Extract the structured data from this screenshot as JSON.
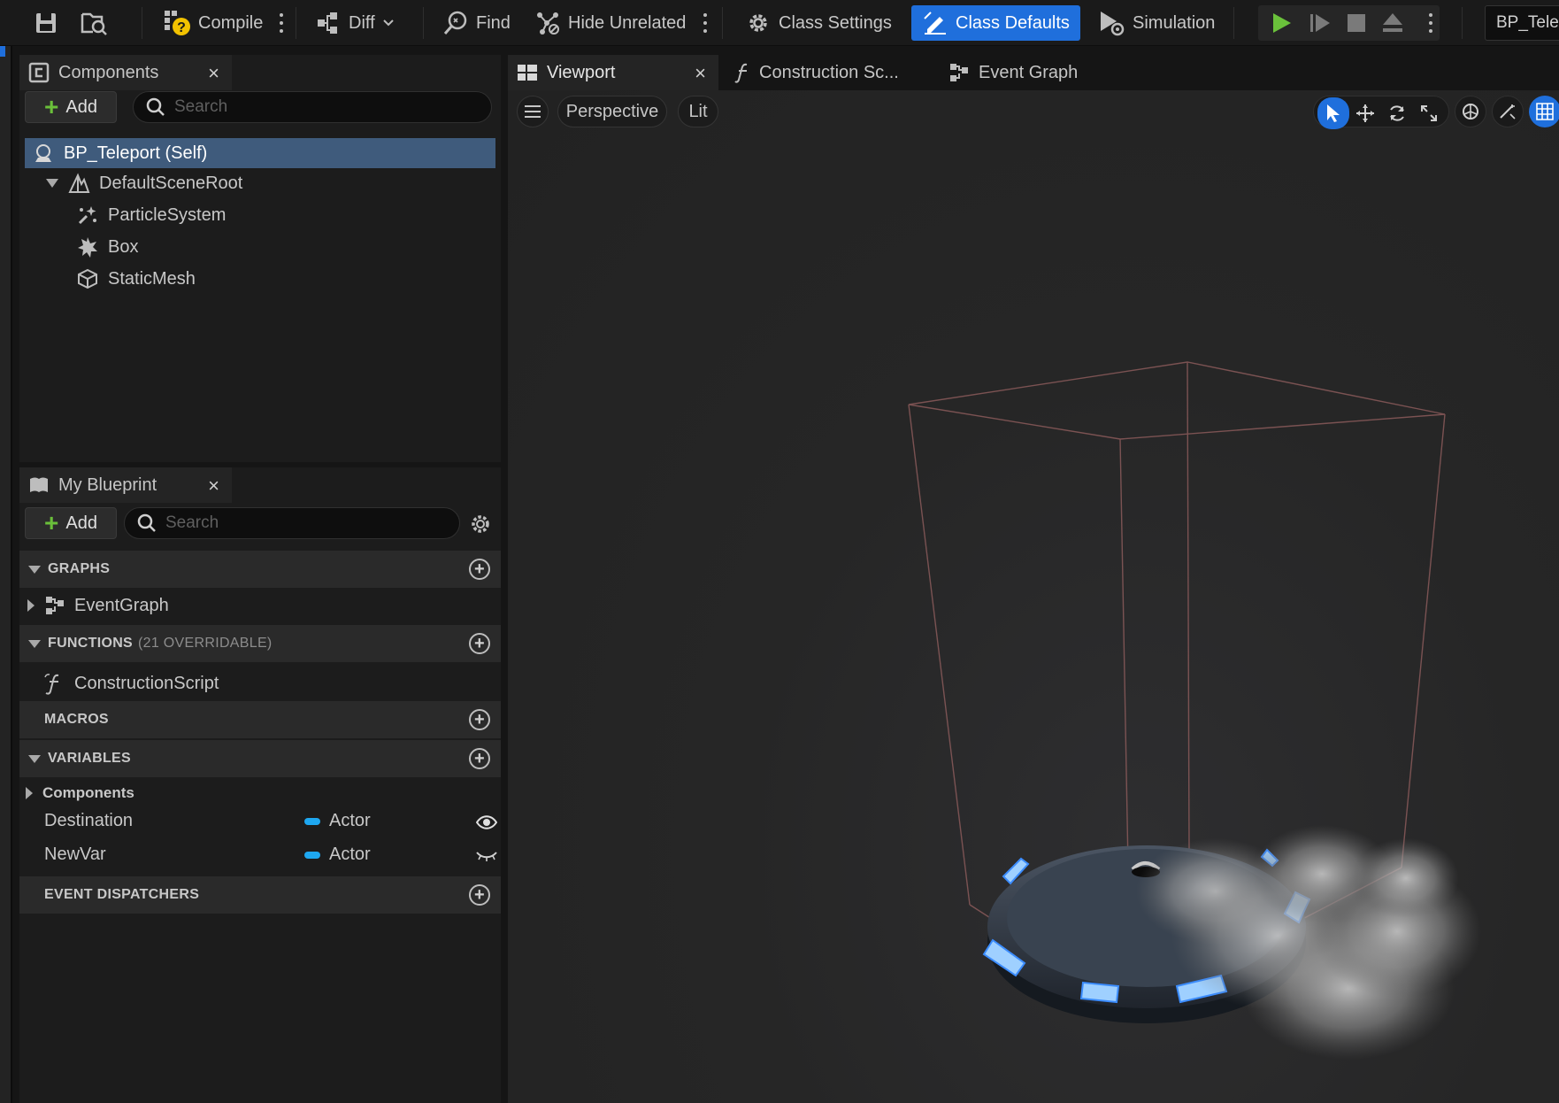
{
  "toolbar": {
    "compile_label": "Compile",
    "diff_label": "Diff",
    "find_label": "Find",
    "hide_unrelated_label": "Hide Unrelated",
    "class_settings_label": "Class Settings",
    "class_defaults_label": "Class Defaults",
    "simulation_label": "Simulation",
    "blueprint_name": "BP_Tele",
    "accent_color": "#1f6fdc",
    "play_color": "#6ac13b"
  },
  "components_panel": {
    "tab_label": "Components",
    "close_glyph": "×",
    "add_label": "Add",
    "search_placeholder": "Search",
    "tree": [
      {
        "label": "BP_Teleport (Self)",
        "icon": "actor-icon",
        "selected": true
      },
      {
        "label": "DefaultSceneRoot",
        "icon": "scene-root-icon",
        "expanded": true
      },
      {
        "label": "ParticleSystem",
        "icon": "particle-icon"
      },
      {
        "label": "Box",
        "icon": "box-collision-icon"
      },
      {
        "label": "StaticMesh",
        "icon": "static-mesh-icon"
      }
    ]
  },
  "my_blueprint_panel": {
    "tab_label": "My Blueprint",
    "close_glyph": "×",
    "add_label": "Add",
    "search_placeholder": "Search",
    "sections": {
      "graphs": {
        "label": "GRAPHS",
        "items": [
          "EventGraph"
        ]
      },
      "functions": {
        "label": "FUNCTIONS",
        "sub": "(21 OVERRIDABLE)",
        "items": [
          "ConstructionScript"
        ]
      },
      "macros": {
        "label": "MACROS"
      },
      "variables": {
        "label": "VARIABLES",
        "category": "Components",
        "items": [
          {
            "name": "Destination",
            "type": "Actor",
            "visibility": "eye-open-icon"
          },
          {
            "name": "NewVar",
            "type": "Actor",
            "visibility": "eye-closed-icon"
          }
        ]
      },
      "event_dispatchers": {
        "label": "EVENT DISPATCHERS"
      }
    },
    "variable_type_color": "#1ea7f0"
  },
  "viewport": {
    "tabs": [
      {
        "label": "Viewport",
        "active": true,
        "close_glyph": "×"
      },
      {
        "label": "Construction Sc...",
        "active": false
      },
      {
        "label": "Event Graph",
        "active": false
      }
    ],
    "perspective_label": "Perspective",
    "lit_label": "Lit"
  }
}
